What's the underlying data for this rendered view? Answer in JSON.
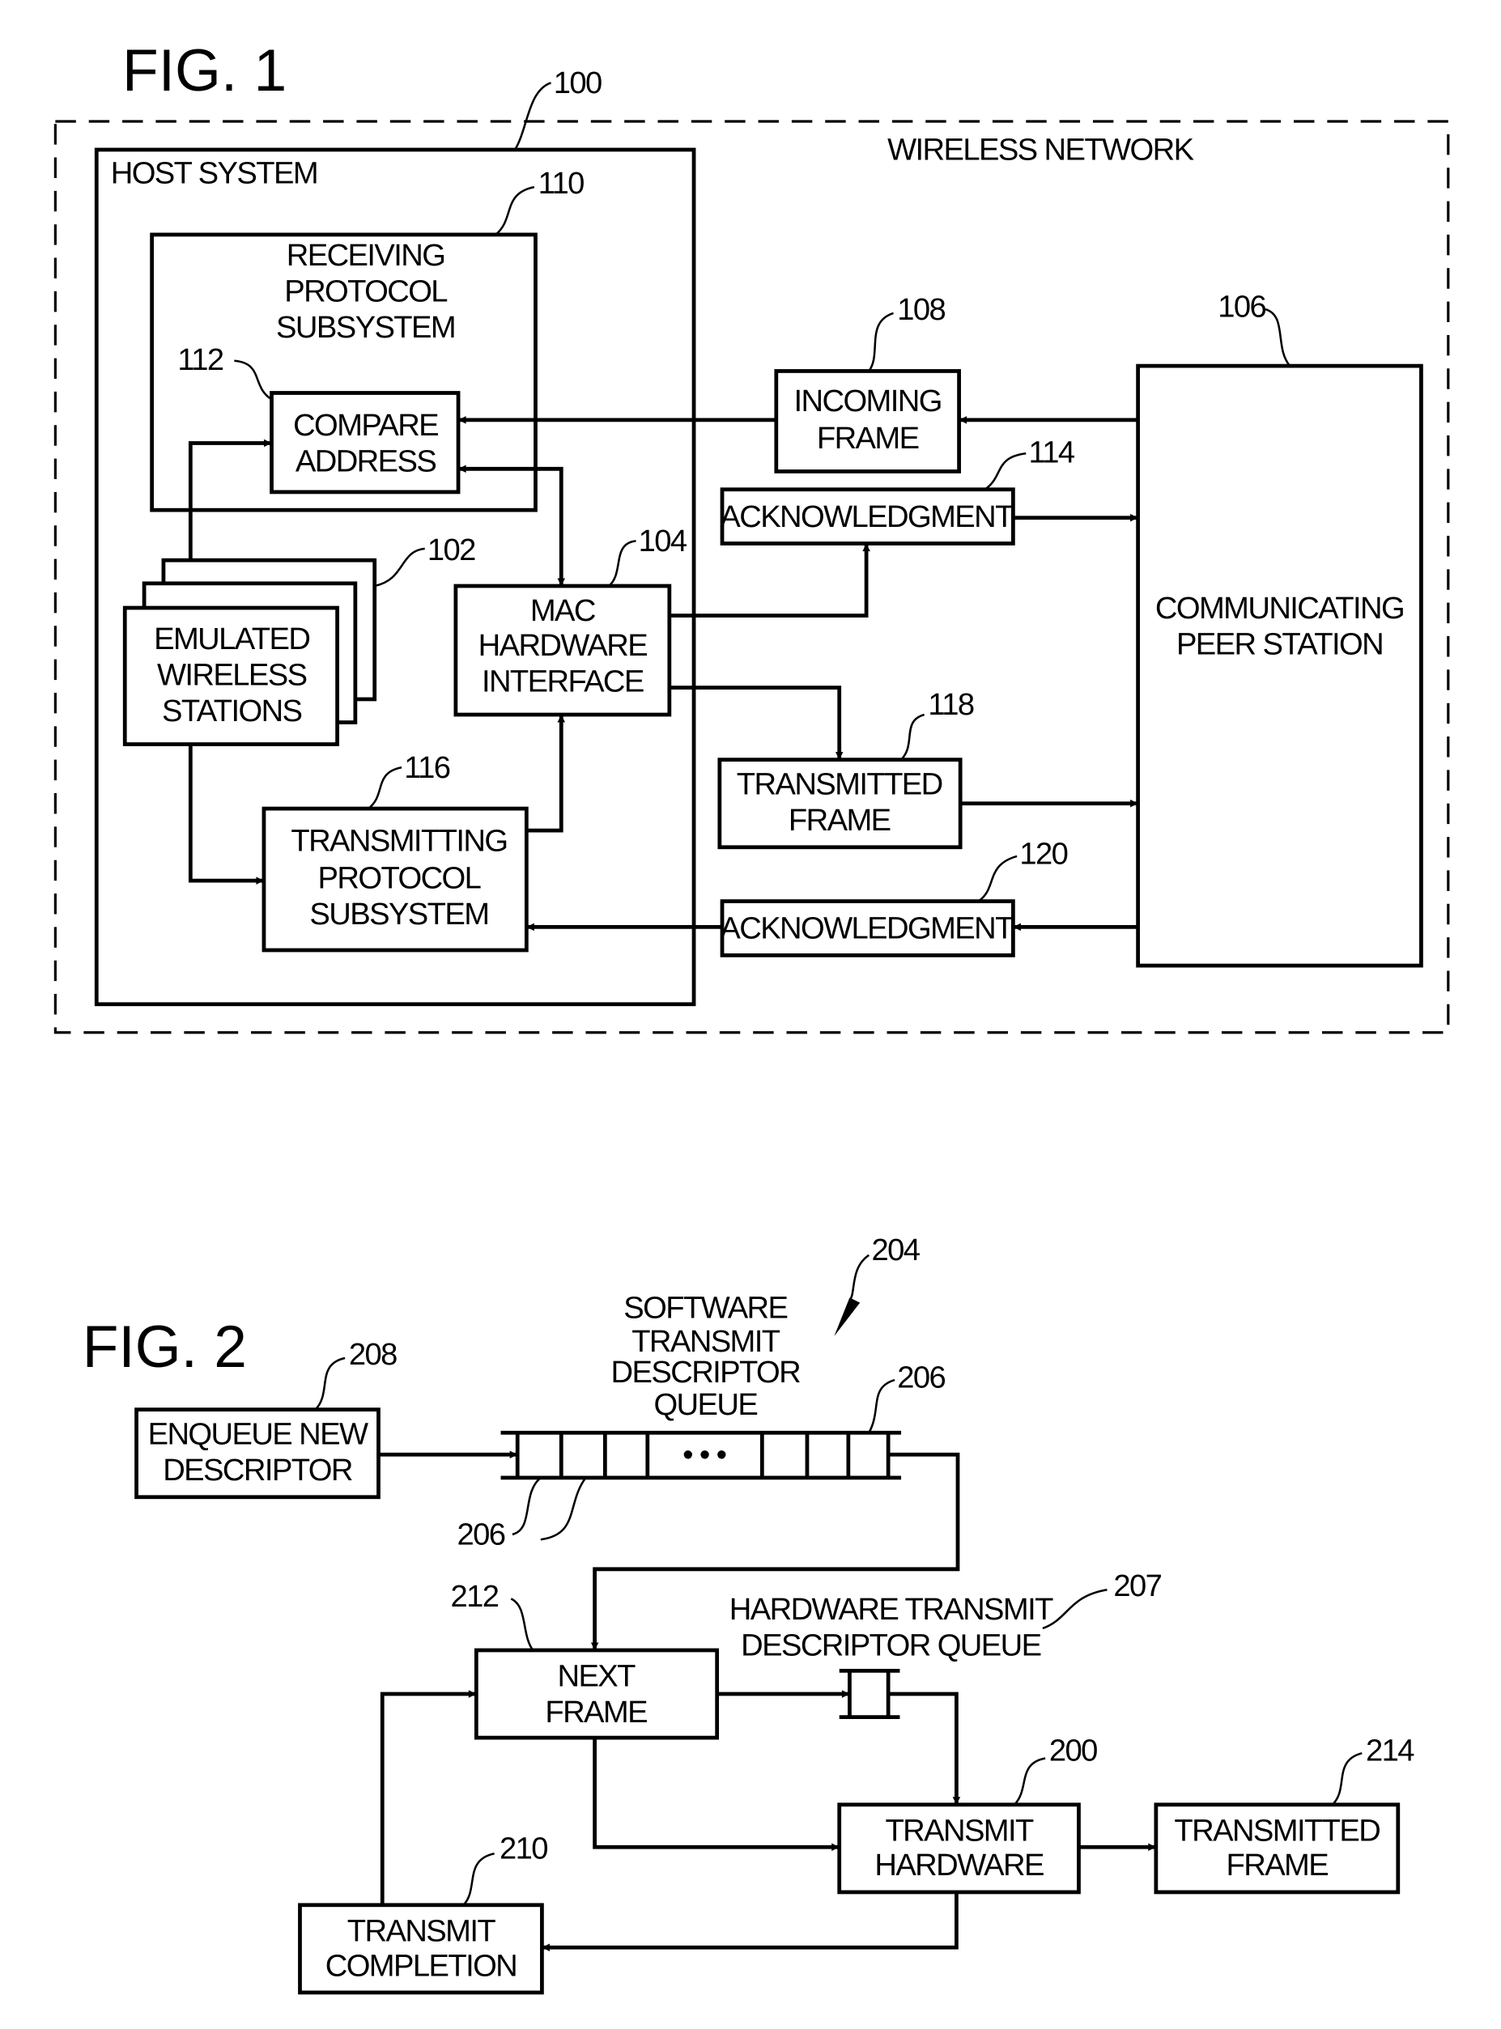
{
  "fig1": {
    "title": "FIG. 1",
    "refs": {
      "network": "100",
      "emulated": "102",
      "mac": "104",
      "peer": "106",
      "incoming": "108",
      "receiving": "110",
      "compare": "112",
      "ack1": "114",
      "transmitting": "116",
      "txframe": "118",
      "ack2": "120"
    },
    "labels": {
      "wireless_network": "WIRELESS NETWORK",
      "host_system": "HOST SYSTEM",
      "receiving": [
        "RECEIVING",
        "PROTOCOL",
        "SUBSYSTEM"
      ],
      "compare": [
        "COMPARE",
        "ADDRESS"
      ],
      "emulated": [
        "EMULATED",
        "WIRELESS",
        "STATIONS"
      ],
      "mac": [
        "MAC",
        "HARDWARE",
        "INTERFACE"
      ],
      "transmitting": [
        "TRANSMITTING",
        "PROTOCOL",
        "SUBSYSTEM"
      ],
      "incoming": [
        "INCOMING",
        "FRAME"
      ],
      "ack1": "ACKNOWLEDGMENT",
      "txframe": [
        "TRANSMITTED",
        "FRAME"
      ],
      "ack2": "ACKNOWLEDGMENT",
      "peer": [
        "COMMUNICATING",
        "PEER STATION"
      ]
    }
  },
  "fig2": {
    "title": "FIG. 2",
    "refs": {
      "hw": "200",
      "swq": "204",
      "slot_top": "206",
      "slot_bottom": "206",
      "hwq": "207",
      "enqueue": "208",
      "completion": "210",
      "next": "212",
      "txframe": "214"
    },
    "labels": {
      "enqueue": [
        "ENQUEUE NEW",
        "DESCRIPTOR"
      ],
      "swq": [
        "SOFTWARE",
        "TRANSMIT",
        "DESCRIPTOR",
        "QUEUE"
      ],
      "ellipsis": "• • •",
      "hwq": [
        "HARDWARE TRANSMIT",
        "DESCRIPTOR QUEUE"
      ],
      "next": [
        "NEXT",
        "FRAME"
      ],
      "hw": [
        "TRANSMIT",
        "HARDWARE"
      ],
      "txframe": [
        "TRANSMITTED",
        "FRAME"
      ],
      "completion": [
        "TRANSMIT",
        "COMPLETION"
      ]
    }
  }
}
